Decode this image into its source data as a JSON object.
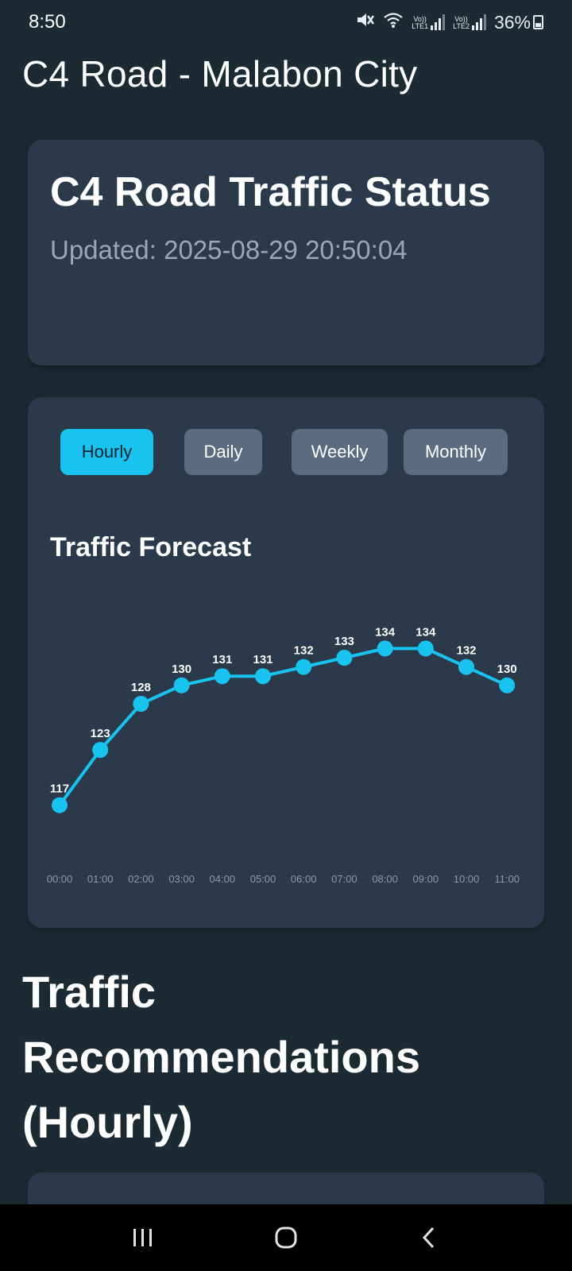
{
  "status_bar": {
    "time": "8:50",
    "battery": "36%",
    "sim1_label": "LTE1",
    "sim2_label": "LTE2",
    "vol_label": "Vo))"
  },
  "app": {
    "title": "C4 Road - Malabon City"
  },
  "status_card": {
    "title": "C4 Road Traffic Status",
    "updated": "Updated: 2025-08-29 20:50:04"
  },
  "tabs": [
    {
      "label": "Hourly",
      "active": true
    },
    {
      "label": "Daily",
      "active": false
    },
    {
      "label": "Weekly",
      "active": false
    },
    {
      "label": "Monthly",
      "active": false
    }
  ],
  "chart_title": "Traffic Forecast",
  "recommendations": {
    "title": "Traffic Recommendations (Hourly)"
  },
  "colors": {
    "accent": "#19c3f0",
    "background": "#1b2a33",
    "card": "#2a3a4a",
    "tab_inactive": "#5a6c80",
    "muted_text": "#9aa8b4"
  },
  "icons": {
    "mute": "mute-icon",
    "wifi": "wifi-icon",
    "signal": "signal-icon",
    "battery": "battery-icon",
    "recents": "recents-icon",
    "home": "home-icon",
    "back": "back-icon"
  },
  "chart_data": {
    "type": "line",
    "title": "Traffic Forecast",
    "xlabel": "",
    "ylabel": "",
    "categories": [
      "00:00",
      "01:00",
      "02:00",
      "03:00",
      "04:00",
      "05:00",
      "06:00",
      "07:00",
      "08:00",
      "09:00",
      "10:00",
      "11:00"
    ],
    "values": [
      117,
      123,
      128,
      130,
      131,
      131,
      132,
      133,
      134,
      134,
      132,
      130
    ],
    "ylim": [
      113,
      138
    ],
    "grid": false,
    "legend": "none",
    "data_labels": true
  }
}
